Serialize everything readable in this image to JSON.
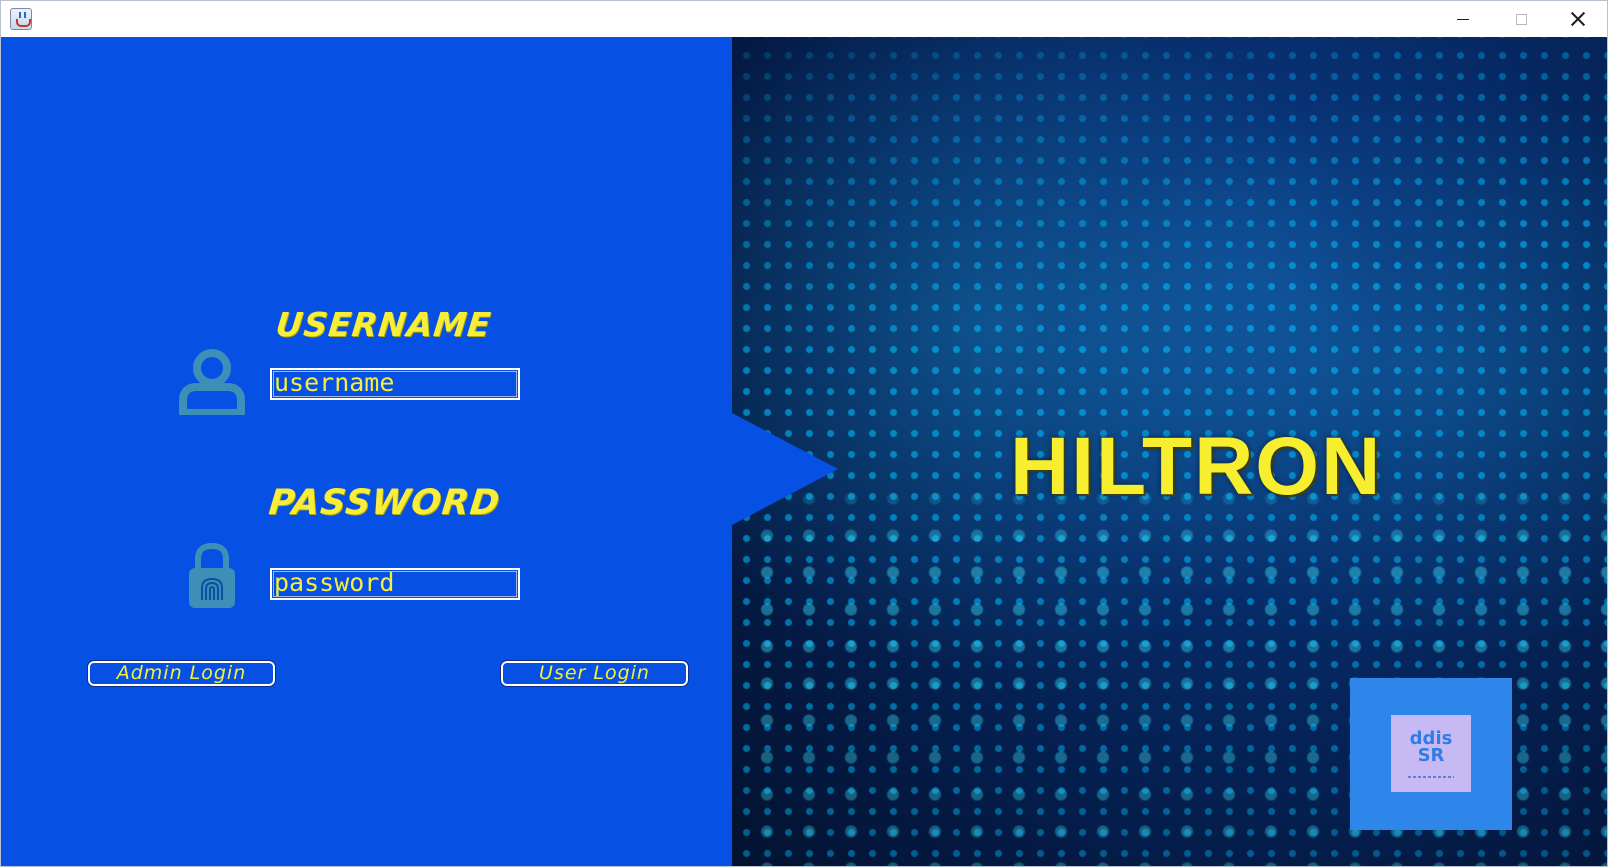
{
  "window": {
    "icon": "java-app-icon",
    "controls": {
      "minimize": "minimize-icon",
      "maximize": "maximize-icon",
      "close": "close-icon"
    }
  },
  "login": {
    "username_title": "USERNAME",
    "username_value": "username",
    "password_title": "PASSWORD",
    "password_value": "password",
    "admin_button": "Admin Login",
    "user_button": "User Login",
    "user_icon": "user-icon",
    "lock_icon": "fingerprint-lock-icon"
  },
  "brand": {
    "title": "HILTRON",
    "logo_text": "ddis\nSR"
  },
  "colors": {
    "panel_blue": "#0651e4",
    "accent_yellow": "#f8ee3a",
    "icon_teal": "#3d8fb8",
    "logo_blue": "#2f86ea",
    "logo_lilac": "#c6b9f4"
  }
}
